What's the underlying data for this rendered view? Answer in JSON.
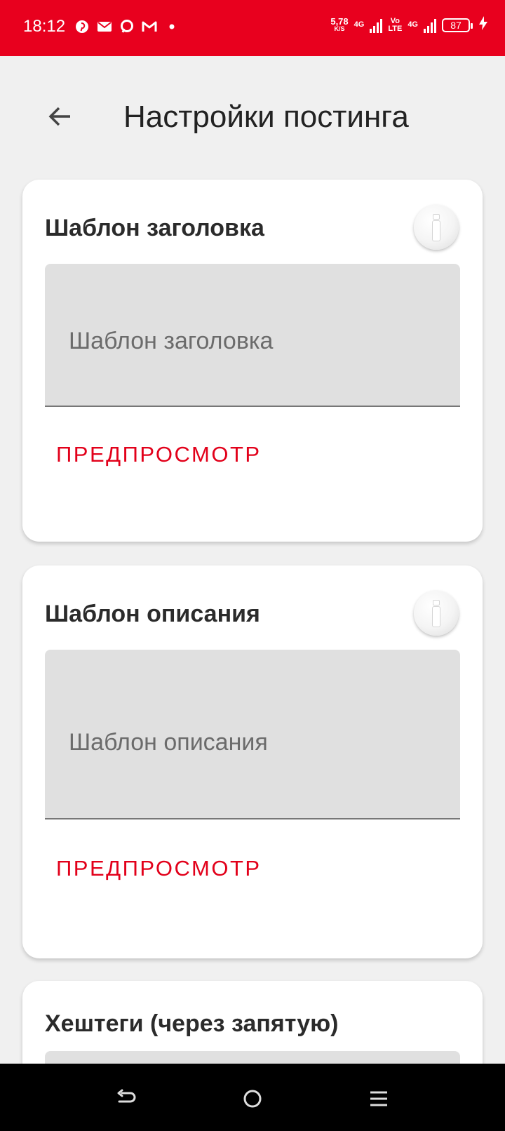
{
  "status_bar": {
    "time": "18:12",
    "speed_value": "5,78",
    "speed_unit": "K/S",
    "net1": "4G",
    "volte_top": "Vo",
    "volte_bottom": "LTE",
    "net2": "4G",
    "battery": "87",
    "background": "#e8001e"
  },
  "header": {
    "title": "Настройки постинга"
  },
  "cards": [
    {
      "title": "Шаблон заголовка",
      "placeholder": "Шаблон заголовка",
      "preview_label": "ПРЕДПРОСМОТР"
    },
    {
      "title": "Шаблон описания",
      "placeholder": "Шаблон описания",
      "preview_label": "ПРЕДПРОСМОТР"
    },
    {
      "title": "Хештеги (через запятую)"
    }
  ],
  "colors": {
    "accent": "#e2001a",
    "background": "#f0f0f0"
  },
  "icons": [
    "pinterest-icon",
    "mail-icon",
    "chat-icon",
    "gmail-icon",
    "notification-dot-icon",
    "back-arrow-icon",
    "info-icon",
    "nav-back-icon",
    "nav-home-icon",
    "nav-menu-icon"
  ]
}
